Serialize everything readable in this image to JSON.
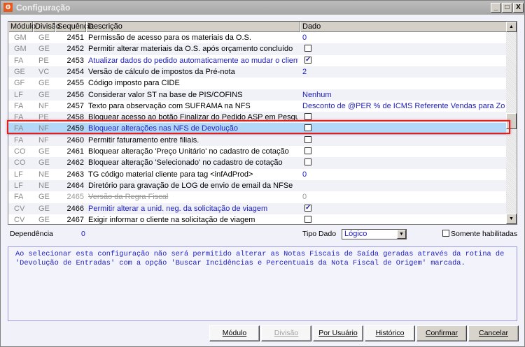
{
  "window": {
    "title": "Configuração",
    "minimize": "_",
    "maximize": "□",
    "close": "X"
  },
  "table": {
    "headers": [
      "Módulo",
      "Divisão",
      "Sequência",
      "Descrição",
      "Dado"
    ],
    "rows": [
      {
        "mod": "GM",
        "div": "GE",
        "seq": "2451",
        "desc": "Permissão de acesso para os materiais da O.S.",
        "dado": "0",
        "type": "text"
      },
      {
        "mod": "GM",
        "div": "GE",
        "seq": "2452",
        "desc": "Permitir alterar materiais da O.S. após orçamento concluído",
        "type": "check",
        "checked": false
      },
      {
        "mod": "FA",
        "div": "PE",
        "seq": "2453",
        "desc": "Atualizar dados do pedido automaticamente ao mudar o cliente",
        "type": "check",
        "checked": true,
        "blue": true
      },
      {
        "mod": "GE",
        "div": "VC",
        "seq": "2454",
        "desc": "Versão de cálculo de impostos da Pré-nota",
        "dado": "2",
        "type": "text"
      },
      {
        "mod": "GF",
        "div": "GE",
        "seq": "2455",
        "desc": "Código imposto para CIDE",
        "dado": "",
        "type": "text"
      },
      {
        "mod": "LF",
        "div": "GE",
        "seq": "2456",
        "desc": "Considerar valor ST na base de PIS/COFINS",
        "dado": "Nenhum",
        "type": "text"
      },
      {
        "mod": "FA",
        "div": "NF",
        "seq": "2457",
        "desc": "Texto para observação com SUFRAMA na NFS",
        "dado": "Desconto de @PER % de ICMS Referente Vendas para Zona Franca: R$ @",
        "type": "text"
      },
      {
        "mod": "FA",
        "div": "PE",
        "seq": "2458",
        "desc": "Bloquear acesso ao botão Finalizar do Pedido ASP em Pesquisa",
        "type": "check",
        "checked": false
      },
      {
        "mod": "FA",
        "div": "NF",
        "seq": "2459",
        "desc": "Bloquear alterações nas NFS de Devolução",
        "type": "check",
        "checked": false,
        "blue": true,
        "selected": true
      },
      {
        "mod": "FA",
        "div": "NF",
        "seq": "2460",
        "desc": "Permitir faturamento entre filiais.",
        "type": "check",
        "checked": false
      },
      {
        "mod": "CO",
        "div": "GE",
        "seq": "2461",
        "desc": "Bloquear alteração 'Preço Unitário' no cadastro de cotação",
        "type": "check",
        "checked": false
      },
      {
        "mod": "CO",
        "div": "GE",
        "seq": "2462",
        "desc": "Bloquear alteração 'Selecionado' no cadastro de cotação",
        "type": "check",
        "checked": false
      },
      {
        "mod": "LF",
        "div": "NE",
        "seq": "2463",
        "desc": "TG código material cliente para tag <infAdProd>",
        "dado": "0",
        "type": "text"
      },
      {
        "mod": "LF",
        "div": "NE",
        "seq": "2464",
        "desc": "Diretório para gravação de LOG de envio de email da NFSe",
        "dado": "",
        "type": "text"
      },
      {
        "mod": "FA",
        "div": "GE",
        "seq": "2465",
        "desc": "Versão da Regra Fiscal",
        "dado": "0",
        "type": "text",
        "disabled": true
      },
      {
        "mod": "CV",
        "div": "GE",
        "seq": "2466",
        "desc": "Permitir alterar a unid. neg. da solicitação de viagem",
        "type": "check",
        "checked": true,
        "blue": true
      },
      {
        "mod": "CV",
        "div": "GE",
        "seq": "2467",
        "desc": "Exigir informar o cliente na solicitação de viagem",
        "type": "check",
        "checked": false
      }
    ]
  },
  "footer": {
    "dependencia_label": "Dependência",
    "dependencia_value": "0",
    "tipo_dado_label": "Tipo Dado",
    "tipo_dado_value": "Lógico",
    "somente_label": "Somente habilitadas",
    "info": "Ao selecionar esta configuração não será permitido alterar as Notas Fiscais de Saída geradas através da rotina de 'Devolução de Entradas' com a opção 'Buscar Incidências e Percentuais da Nota Fiscal de Origem' marcada."
  },
  "buttons": {
    "modulo": "Módulo",
    "divisao": "Divisão",
    "por_usuario": "Por Usuário",
    "historico": "Histórico",
    "confirmar": "Confirmar",
    "cancelar": "Cancelar"
  }
}
